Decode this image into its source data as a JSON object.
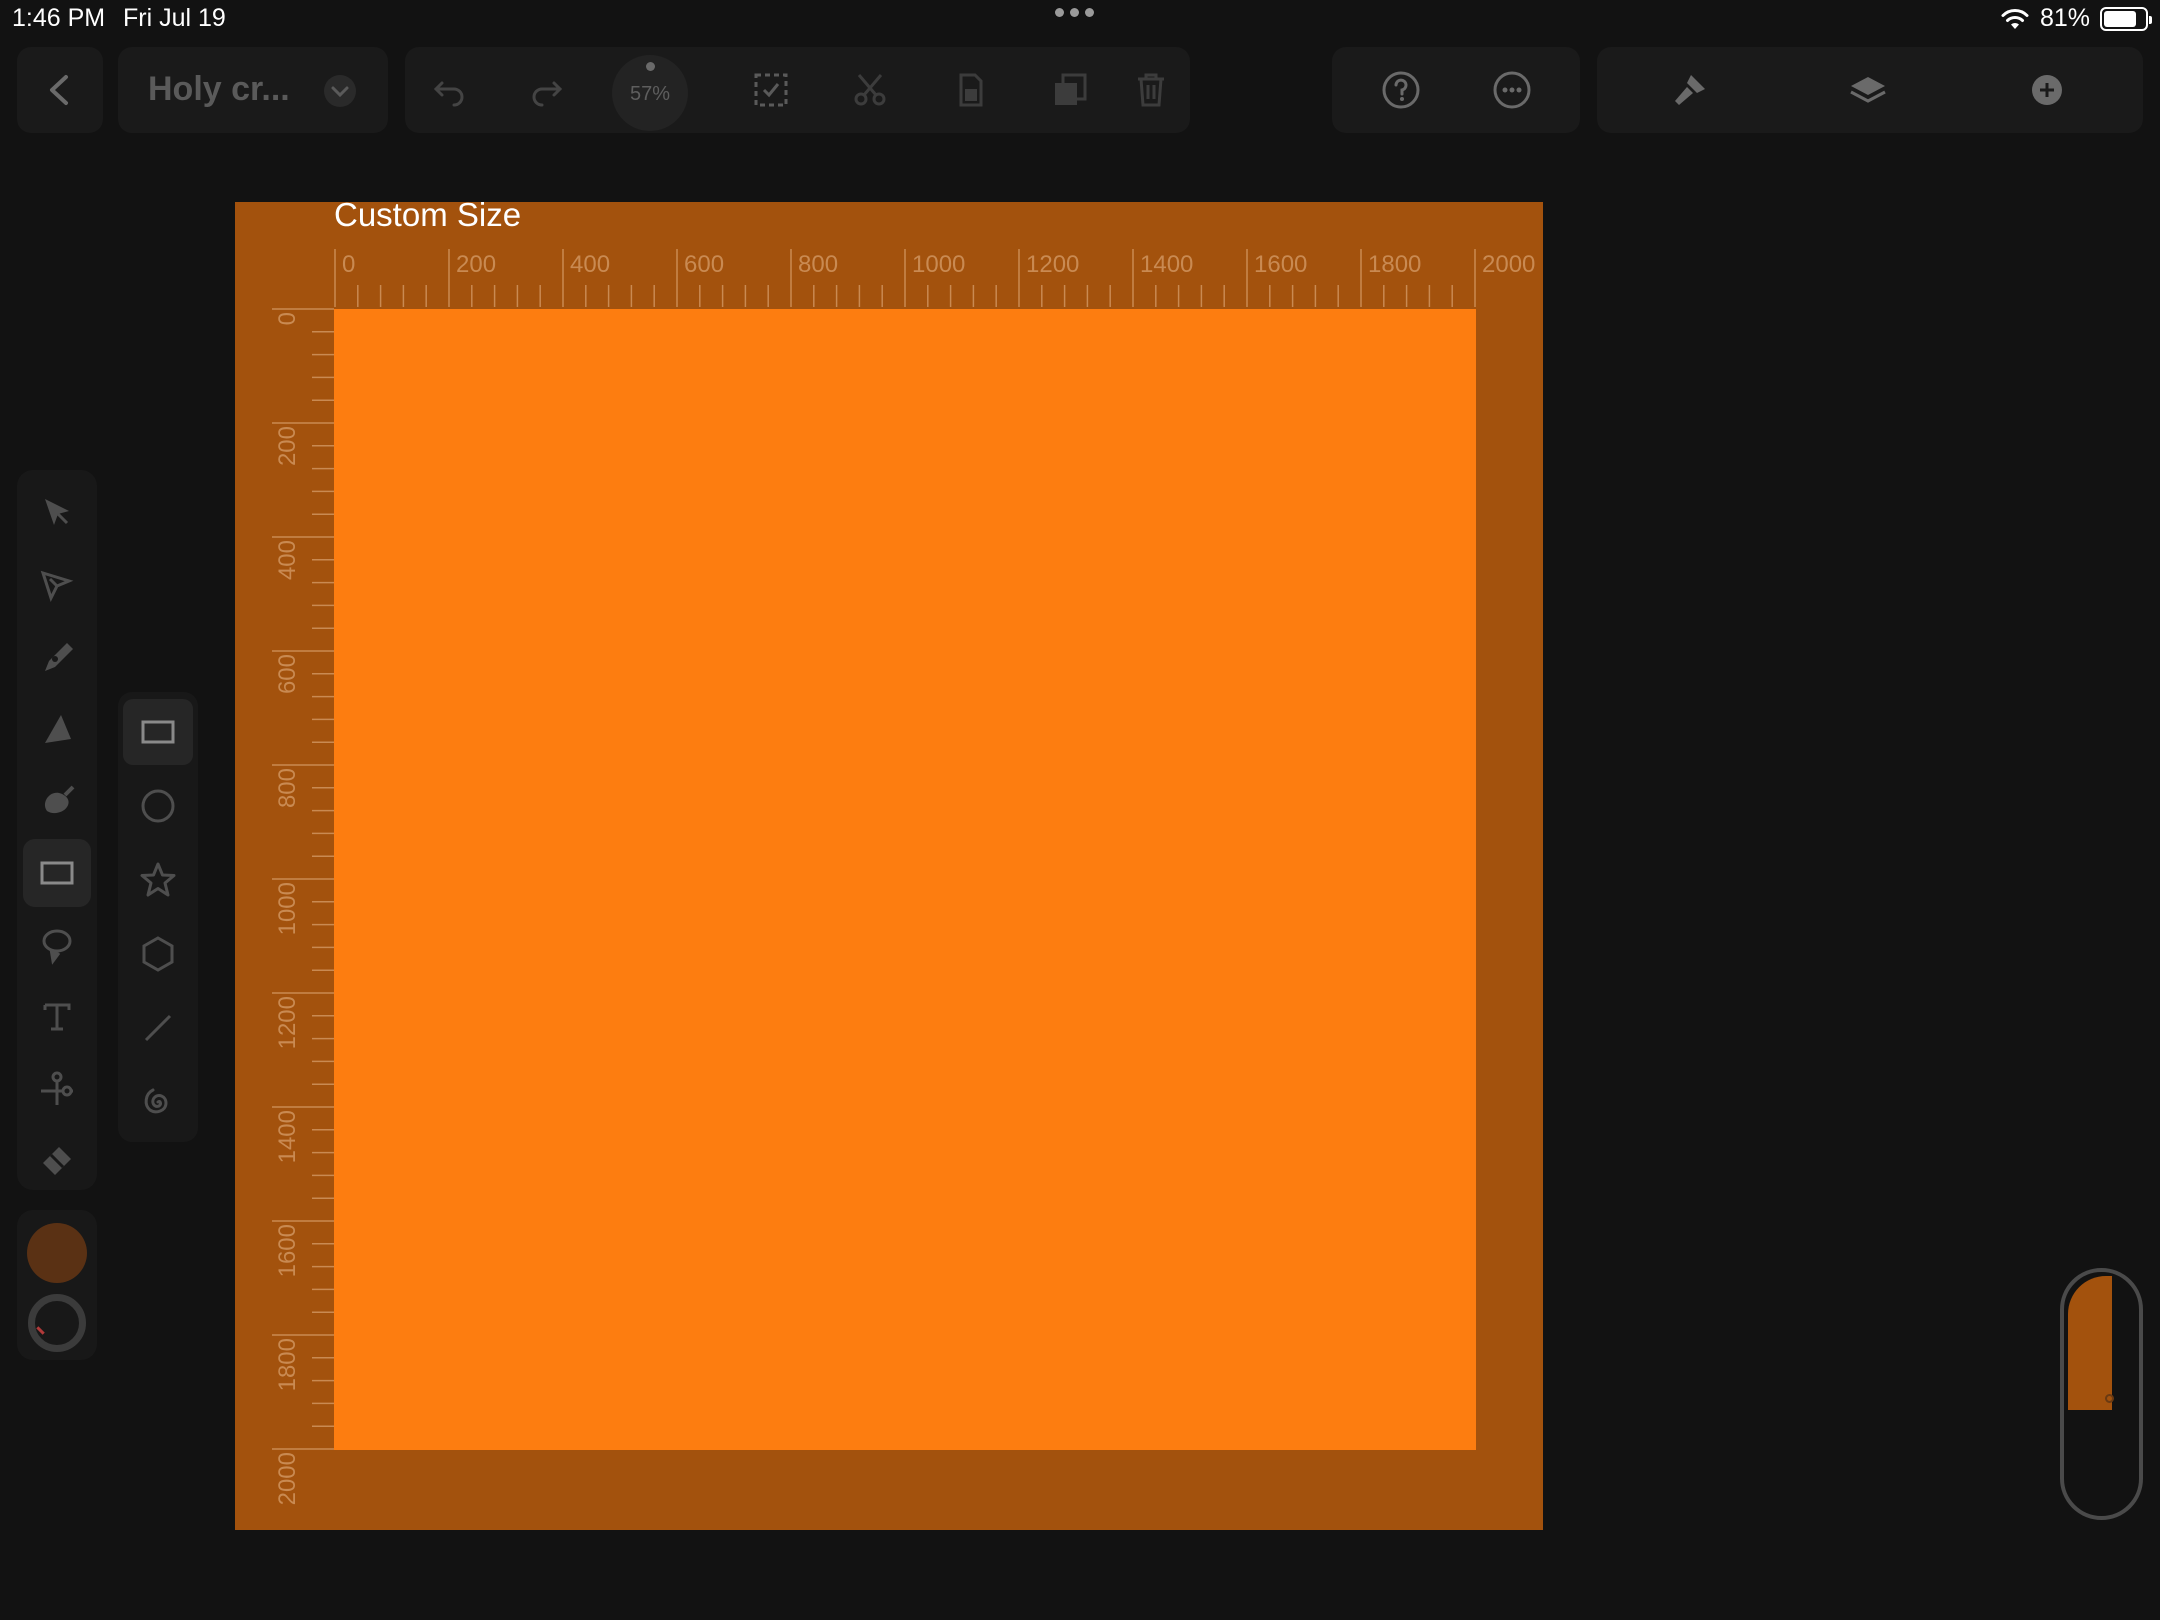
{
  "status_bar": {
    "time": "1:46 PM",
    "date": "Fri Jul 19",
    "battery_text": "81%",
    "battery_level": 0.81,
    "icons": [
      "multitask-dots-icon",
      "wifi-icon",
      "battery-icon"
    ]
  },
  "toolbar": {
    "document_title": "Holy cr...",
    "zoom": "57%",
    "icons": [
      "back-icon",
      "chevron-down-icon",
      "undo-icon",
      "redo-icon",
      "select-all-icon",
      "cut-icon",
      "copy-icon",
      "paste-icon",
      "trash-icon",
      "help-icon",
      "more-icon",
      "style-brush-icon",
      "layers-icon",
      "add-icon"
    ]
  },
  "tools": {
    "items": [
      "select",
      "direct-select",
      "pen",
      "vector-brush",
      "brush",
      "shapes",
      "lasso",
      "text",
      "scissors",
      "eraser"
    ],
    "active": "shapes",
    "fill_color": "#5a3114",
    "stroke_color": "#3b3b3b"
  },
  "shapes": {
    "items": [
      "rectangle",
      "ellipse",
      "star",
      "polygon",
      "line",
      "spiral"
    ],
    "active": "rectangle"
  },
  "artboard": {
    "title": "Custom Size",
    "background_color": "#a3520d",
    "shape_color": "#fd7d10",
    "ruler_labels": [
      "0",
      "200",
      "400",
      "600",
      "800",
      "1000",
      "1200",
      "1400",
      "1600",
      "1800",
      "2000"
    ]
  },
  "slider": {
    "level": 0.55
  }
}
